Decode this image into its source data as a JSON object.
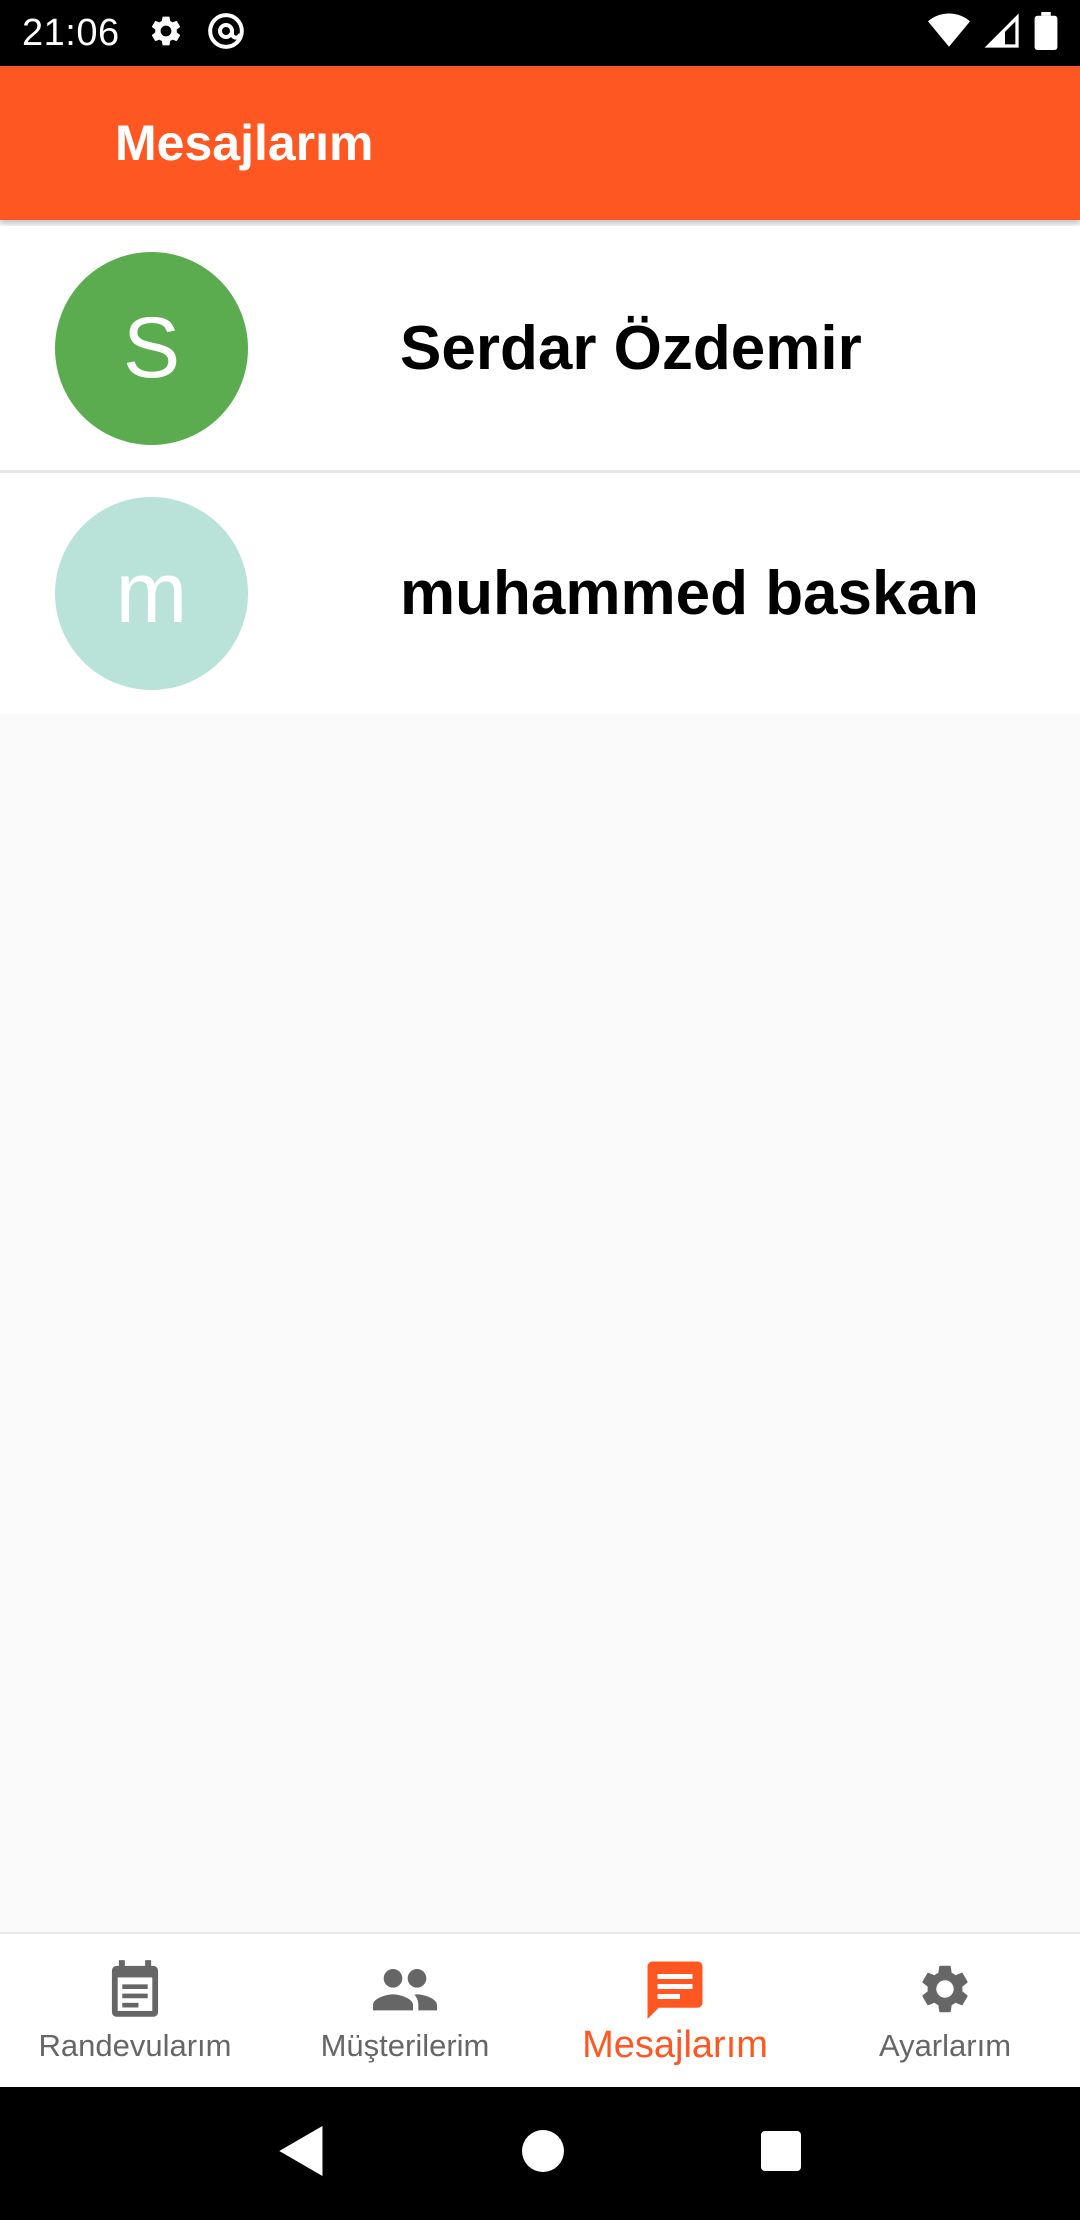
{
  "status_bar": {
    "time": "21:06",
    "icons": [
      "settings-icon",
      "at-sign-icon",
      "wifi-icon",
      "signal-icon",
      "battery-icon"
    ]
  },
  "app_bar": {
    "title": "Mesajlarım",
    "color": "#ff5722"
  },
  "conversations": [
    {
      "initial": "S",
      "name": "Serdar Özdemir",
      "avatar_color": "#5aac4e"
    },
    {
      "initial": "m",
      "name": "muhammed baskan",
      "avatar_color": "#b9e2d8"
    }
  ],
  "bottom_nav": {
    "items": [
      {
        "label": "Randevularım",
        "icon": "calendar-icon",
        "active": false
      },
      {
        "label": "Müşterilerim",
        "icon": "people-icon",
        "active": false
      },
      {
        "label": "Mesajlarım",
        "icon": "message-icon",
        "active": true
      },
      {
        "label": "Ayarlarım",
        "icon": "gear-icon",
        "active": false
      }
    ],
    "active_color": "#ff5722",
    "inactive_color": "#666666"
  },
  "system_nav": {
    "icons": [
      "back-icon",
      "home-icon",
      "recents-icon"
    ]
  }
}
